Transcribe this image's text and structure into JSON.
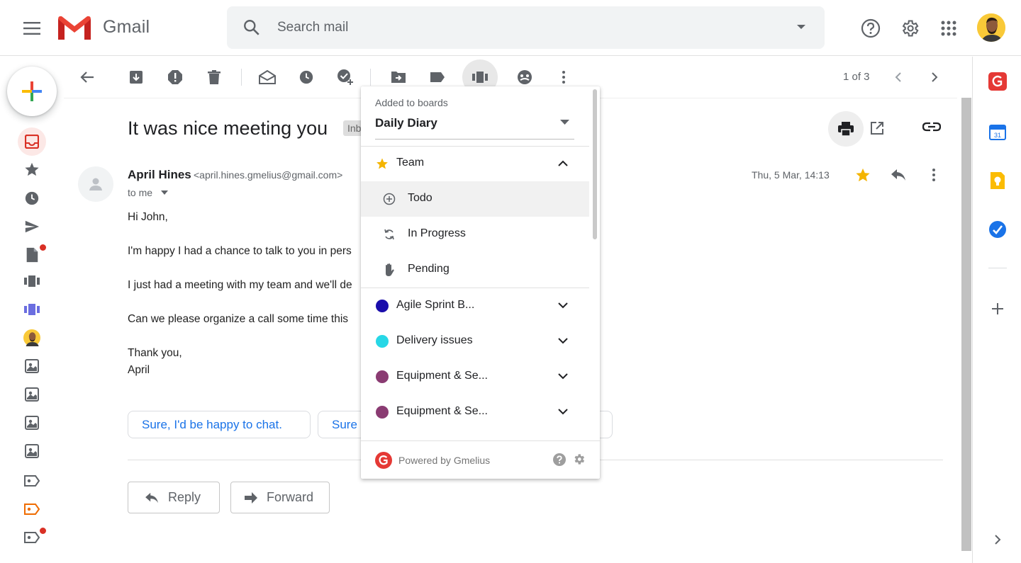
{
  "app": {
    "name": "Gmail"
  },
  "search": {
    "placeholder": "Search mail"
  },
  "toolbar": {
    "pager": "1 of 3"
  },
  "email": {
    "subject": "It was nice meeting you",
    "label_chip": "Inbox",
    "sender_name": "April Hines",
    "sender_email": "<april.hines.gmelius@gmail.com>",
    "recipient": "to me",
    "date": "Thu, 5 Mar, 14:13",
    "body": [
      "Hi John,",
      "I'm happy I had a chance to talk to you in pers",
      "I just had a meeting with my team and we'll de",
      "Can we please organize a call some time this",
      "Thank you,",
      "April"
    ],
    "smart_replies": [
      "Sure, I'd be happy to chat.",
      "Sure"
    ],
    "actions": {
      "reply": "Reply",
      "forward": "Forward"
    }
  },
  "popover": {
    "label": "Added to boards",
    "selected_board": "Daily Diary",
    "groups": [
      {
        "name": "Team",
        "icon": "star-icon",
        "color": "#f4b400",
        "expanded": true
      },
      {
        "name": "Agile Sprint B...",
        "color": "#1a0dab"
      },
      {
        "name": "Delivery issues",
        "color": "#27d7e6"
      },
      {
        "name": "Equipment & Se...",
        "color": "#8a3b72"
      },
      {
        "name": "Equipment & Se...",
        "color": "#8a3b72"
      }
    ],
    "team_items": [
      {
        "name": "Todo",
        "icon": "add-circle-icon"
      },
      {
        "name": "In Progress",
        "icon": "sync-icon"
      },
      {
        "name": "Pending",
        "icon": "hand-icon"
      }
    ],
    "footer": "Powered by Gmelius"
  },
  "colors": {
    "accent": "#1a73e8",
    "gmail_red": "#ea4335",
    "gmelius_red": "#e53935",
    "star": "#f4b400"
  }
}
